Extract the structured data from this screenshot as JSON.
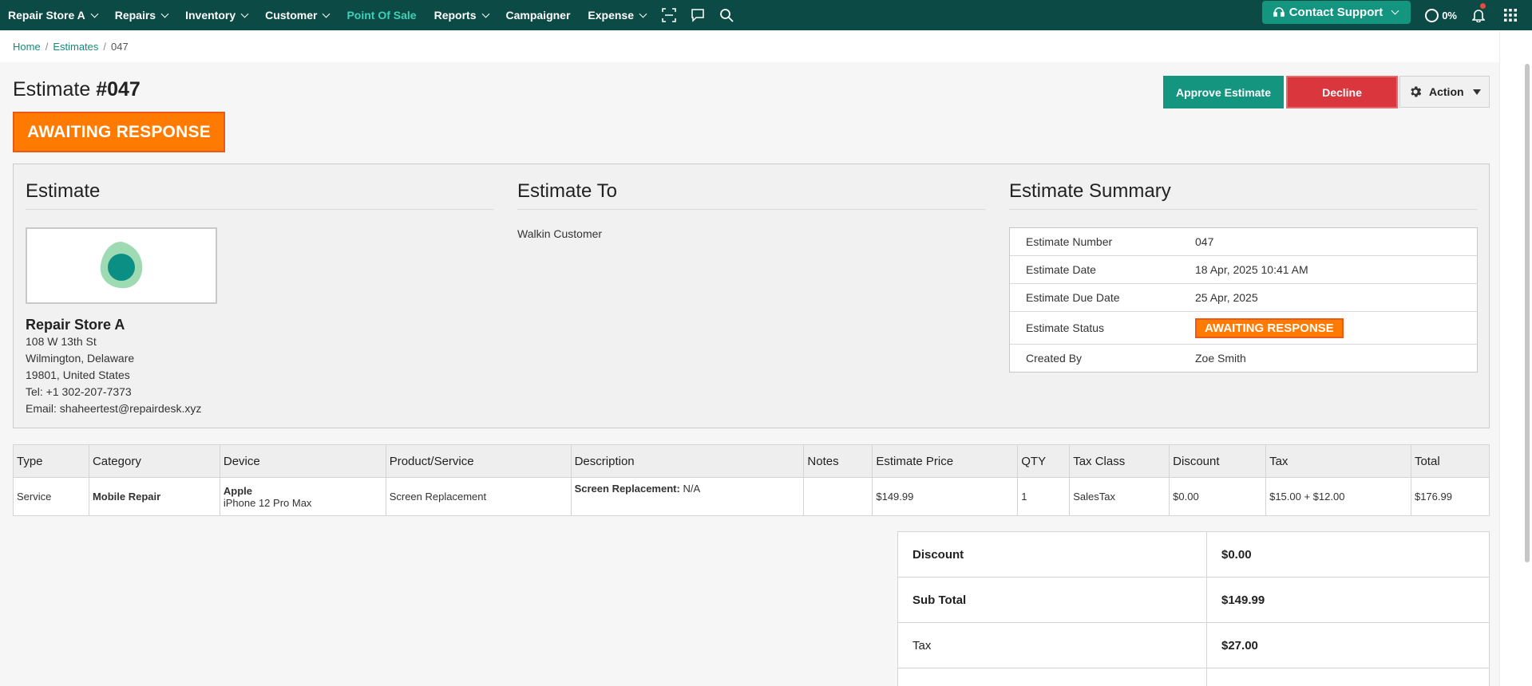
{
  "nav": {
    "items": [
      {
        "label": "Repair Store A",
        "dropdown": true
      },
      {
        "label": "Repairs",
        "dropdown": true
      },
      {
        "label": "Inventory",
        "dropdown": true
      },
      {
        "label": "Customer",
        "dropdown": true
      },
      {
        "label": "Point Of Sale",
        "dropdown": false,
        "active": true
      },
      {
        "label": "Reports",
        "dropdown": true
      },
      {
        "label": "Campaigner",
        "dropdown": false
      },
      {
        "label": "Expense",
        "dropdown": true
      }
    ],
    "support_label": "Contact Support",
    "progress": "0%"
  },
  "breadcrumb": {
    "home": "Home",
    "estimates": "Estimates",
    "current": "047"
  },
  "header": {
    "title_prefix": "Estimate",
    "title_number": "#047",
    "status": "AWAITING RESPONSE",
    "approve_label": "Approve Estimate",
    "decline_label": "Decline",
    "action_label": "Action"
  },
  "estimate": {
    "heading": "Estimate",
    "store_name": "Repair Store A",
    "address_lines": [
      "108 W 13th St",
      "Wilmington, Delaware",
      "19801, United States",
      "Tel: +1 302-207-7373",
      "Email: shaheertest@repairdesk.xyz"
    ]
  },
  "estimate_to": {
    "heading": "Estimate To",
    "customer": "Walkin Customer"
  },
  "summary": {
    "heading": "Estimate Summary",
    "rows": [
      {
        "label": "Estimate Number",
        "value": "047"
      },
      {
        "label": "Estimate Date",
        "value": "18 Apr, 2025 10:41 AM"
      },
      {
        "label": "Estimate Due Date",
        "value": "25 Apr, 2025"
      },
      {
        "label": "Estimate Status",
        "value": "AWAITING RESPONSE"
      },
      {
        "label": "Created By",
        "value": "Zoe Smith"
      }
    ]
  },
  "table": {
    "headers": [
      "Type",
      "Category",
      "Device",
      "Product/Service",
      "Description",
      "Notes",
      "Estimate Price",
      "QTY",
      "Tax Class",
      "Discount",
      "Tax",
      "Total"
    ],
    "row": {
      "type": "Service",
      "category": "Mobile Repair",
      "device_brand": "Apple",
      "device_model": "iPhone 12 Pro Max",
      "product": "Screen Replacement",
      "description_label": "Screen Replacement:",
      "description_value": "N/A",
      "notes": "",
      "price": "$149.99",
      "qty": "1",
      "tax_class": "SalesTax",
      "discount": "$0.00",
      "tax": "$15.00 + $12.00",
      "total": "$176.99"
    }
  },
  "totals": [
    {
      "label": "Discount",
      "value": "$0.00",
      "bold": false
    },
    {
      "label": "Sub Total",
      "value": "$149.99",
      "bold": true
    },
    {
      "label": "Tax",
      "value": "$27.00",
      "bold": false
    },
    {
      "label": "",
      "value": "",
      "bold": false
    }
  ],
  "colors": {
    "nav_bg": "#0b4a45",
    "accent": "#13957f",
    "status_orange": "#ff7a00",
    "decline_red": "#d9363e"
  }
}
